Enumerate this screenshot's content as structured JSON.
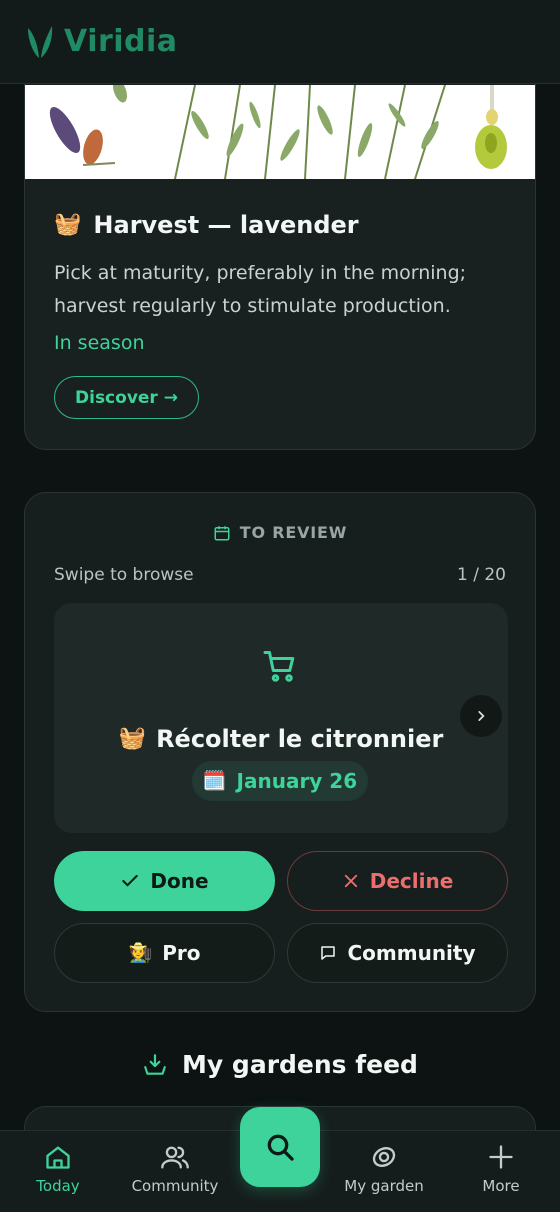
{
  "app": {
    "brand": "Viridia"
  },
  "plant_card": {
    "title": "Harvest — lavender",
    "description": "Pick at maturity, preferably in the morning; harvest regularly to stimulate production.",
    "status": "In season",
    "discover_label": "Discover →"
  },
  "review": {
    "header": "TO REVIEW",
    "swipe_hint": "Swipe to browse",
    "counter": "1 / 20",
    "task_title": "Récolter le citronnier",
    "task_date": "January 26",
    "done_label": "Done",
    "decline_label": "Decline",
    "pro_label": "Pro",
    "community_label": "Community"
  },
  "feed": {
    "title": "My gardens feed"
  },
  "nav": {
    "today": "Today",
    "community": "Community",
    "garden": "My garden",
    "more": "More"
  },
  "colors": {
    "accent": "#3dd39b",
    "decline": "#ec6e6e",
    "background": "#0c1312"
  }
}
